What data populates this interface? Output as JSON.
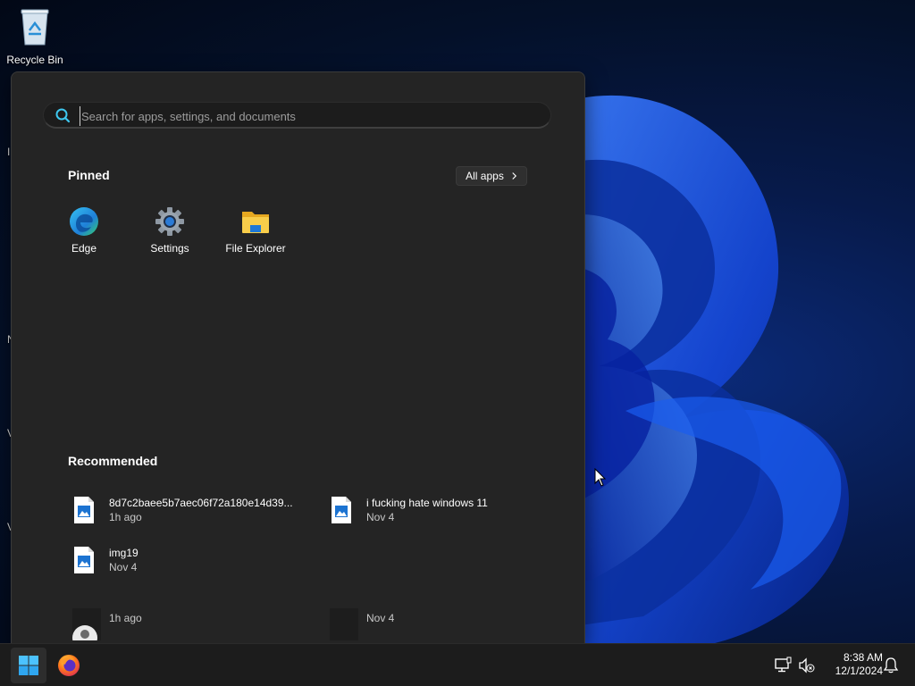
{
  "desktop": {
    "icons": [
      {
        "label": "Recycle Bin",
        "icon": "recycle-bin-icon"
      }
    ],
    "left_edge_fragments": [
      "I",
      "N",
      "V",
      "V"
    ]
  },
  "start_menu": {
    "search": {
      "placeholder": "Search for apps, settings, and documents",
      "value": ""
    },
    "pinned": {
      "title": "Pinned",
      "all_apps_label": "All apps",
      "apps": [
        {
          "label": "Edge",
          "icon": "edge-icon"
        },
        {
          "label": "Settings",
          "icon": "settings-gear-icon"
        },
        {
          "label": "File Explorer",
          "icon": "file-explorer-icon"
        }
      ]
    },
    "recommended": {
      "title": "Recommended",
      "items": [
        {
          "name": "8d7c2baee5b7aec06f72a180e14d39...",
          "time": "1h ago",
          "icon": "image-file-icon"
        },
        {
          "name": "i fucking hate windows 11",
          "time": "Nov 4",
          "icon": "image-file-icon"
        },
        {
          "name": "img19",
          "time": "Nov 4",
          "icon": "image-file-icon"
        },
        {
          "name": "",
          "time": "1h ago",
          "icon": "user-thumbnail-icon"
        },
        {
          "name": "",
          "time": "Nov 4",
          "icon": "dark-thumbnail"
        }
      ]
    }
  },
  "taskbar": {
    "apps": [
      {
        "name": "Start",
        "icon": "windows-start-icon"
      },
      {
        "name": "Firefox",
        "icon": "firefox-icon"
      }
    ],
    "tray": {
      "icons": [
        "network-icon",
        "volume-muted-icon",
        "notification-bell-icon"
      ],
      "time": "8:38 AM",
      "date": "12/1/2024"
    }
  },
  "colors": {
    "accent": "#0078d4",
    "menu_bg": "#242424",
    "taskbar_bg": "#1c1c1c"
  }
}
